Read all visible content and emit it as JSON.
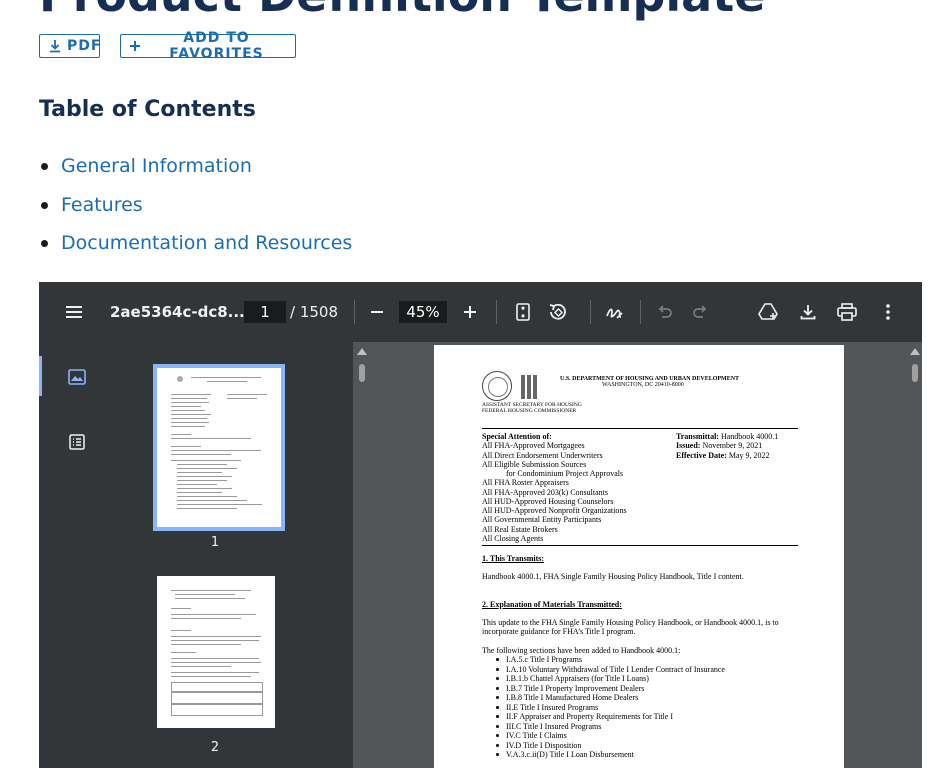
{
  "page": {
    "title": "Product Definition Template",
    "pdf_button": "PDF",
    "favorites_button": "ADD TO FAVORITES",
    "toc_heading": "Table of Contents",
    "toc_items": [
      "General Information",
      "Features",
      "Documentation and Resources"
    ]
  },
  "viewer": {
    "doc_name": "2ae5364c-dc8...",
    "page_current": "1",
    "page_total": "/ 1508",
    "zoom": "45%",
    "thumbnails": [
      {
        "label": "1"
      },
      {
        "label": "2"
      }
    ]
  },
  "doc": {
    "header1": "U.S. DEPARTMENT OF HOUSING AND URBAN DEVELOPMENT",
    "header2": "WASHINGTON, DC 20410-8000",
    "asst1": "ASSISTANT SECRETARY FOR HOUSING",
    "asst2": "FEDERAL HOUSING COMMISSIONER",
    "special_attention": "Special Attention of:",
    "recipients": [
      "All FHA-Approved Mortgagees",
      "All Direct Endorsement Underwriters",
      "All Eligible Submission Sources",
      "for Condominium Project Approvals",
      "All FHA Roster Appraisers",
      "All FHA-Approved 203(k) Consultants",
      "All HUD-Approved Housing Counselors",
      "All HUD-Approved Nonprofit Organizations",
      "All Governmental Entity Participants",
      "All Real Estate Brokers",
      "All Closing Agents"
    ],
    "transmittal_label": "Transmittal:",
    "transmittal_value": "Handbook 4000.1",
    "issued_label": "Issued:",
    "issued_value": "November 9, 2021",
    "effective_label": "Effective Date:",
    "effective_value": "May 9, 2022",
    "section1_title": "1. This Transmits:",
    "section1_text": "Handbook 4000.1, FHA Single Family Housing Policy Handbook, Title I content.",
    "section2_title": "2. Explanation of Materials Transmitted:",
    "section2_text1": "This update to the FHA Single Family Housing Policy Handbook, or Handbook 4000.1, is to",
    "section2_text2": "incorporate guidance for FHA’s Title I program.",
    "added_intro": "The following sections have been added to Handbook 4000.1:",
    "added_sections": [
      "I.A.5.c Title I Programs",
      "I.A.10 Voluntary Withdrawal of Title I Lender Contract of Insurance",
      "I.B.1.b Chattel Appraisers (for Title I Loans)",
      "I.B.7 Title I Property Improvement Dealers",
      "I.B.8 Title I Manufactured Home Dealers",
      "II.E Title I Insured Programs",
      "II.F Appraiser and Property Requirements for Title I",
      "III.C Title I Insured Programs",
      "IV.C Title I Claims",
      "IV.D Title I Disposition",
      "V.A.3.c.ii(D) Title I Loan Disbursement"
    ]
  },
  "icons": {
    "menu": "menu-icon",
    "download": "download-icon",
    "plus": "plus-icon",
    "minus": "minus-icon",
    "fit": "fit-page-icon",
    "rotate": "rotate-icon",
    "annotate": "annotate-icon",
    "undo": "undo-icon",
    "redo": "redo-icon",
    "drive": "save-to-drive-icon",
    "print": "print-icon",
    "more": "more-vert-icon",
    "thumbnails": "thumbnails-icon",
    "outline": "outline-icon"
  },
  "colors": {
    "heading": "#162e51",
    "link": "#1a6db3",
    "toolbar": "#323639",
    "viewer_bg": "#525659",
    "accent": "#8ab4f8"
  }
}
